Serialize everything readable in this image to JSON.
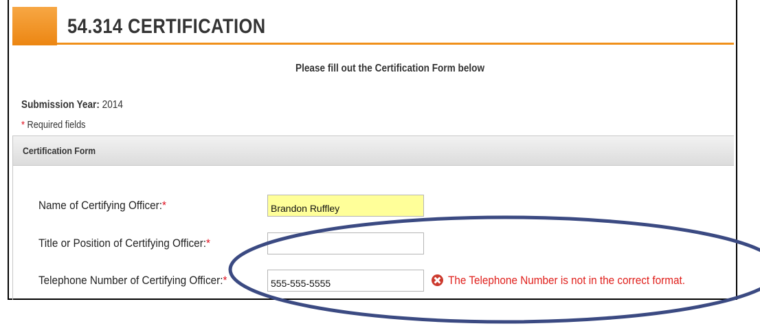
{
  "page": {
    "title": "54.314 CERTIFICATION",
    "instruction": "Please fill out the Certification Form below",
    "submission_label": "Submission Year:",
    "submission_value": "2014",
    "required_star": "*",
    "required_text": "Required fields"
  },
  "form": {
    "header": "Certification Form",
    "fields": [
      {
        "label": "Name of Certifying Officer:",
        "star": "*",
        "value": "Brandon Ruffley"
      },
      {
        "label": "Title or Position of Certifying Officer:",
        "star": "*",
        "value": ""
      },
      {
        "label": "Telephone Number of Certifying Officer:",
        "star": "*",
        "value": "555-555-5555"
      }
    ],
    "error_message": "The Telephone Number is not in the correct format."
  },
  "colors": {
    "accent": "#ec8612",
    "required_star": "#e01020",
    "error": "#e0201c",
    "highlight_fill": "#ffff99",
    "annotation_ellipse": "#3b4a82"
  },
  "icons": {
    "error": "error-x-icon"
  }
}
